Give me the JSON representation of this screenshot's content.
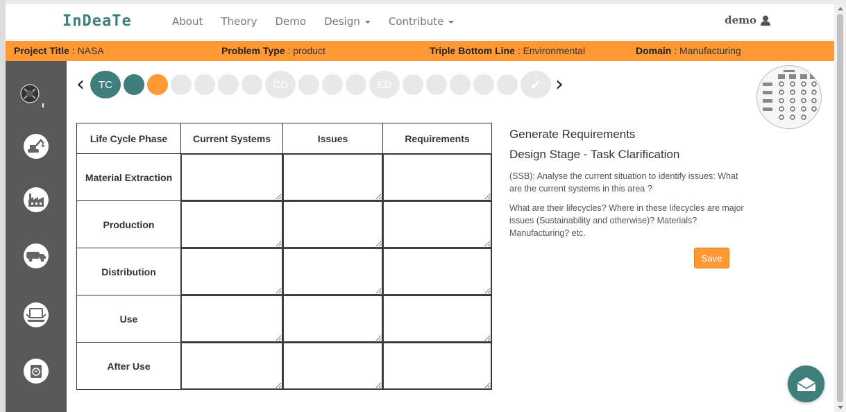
{
  "nav": {
    "brand": "InDeaTe",
    "links": [
      "About",
      "Theory",
      "Demo",
      "Design",
      "Contribute"
    ],
    "user": "demo"
  },
  "infobar": [
    {
      "label": "Project Title",
      "value": "NASA"
    },
    {
      "label": "Problem Type",
      "value": "product"
    },
    {
      "label": "Triple Bottom Line",
      "value": "Environmental"
    },
    {
      "label": "Domain",
      "value": "Manufacturing"
    }
  ],
  "sidebar": {
    "icons": [
      "gear-cycle-icon",
      "excavator-icon",
      "factory-icon",
      "truck-icon",
      "laptop-icon",
      "recycle-bin-icon"
    ]
  },
  "stepper": {
    "steps": [
      "TC",
      "",
      "",
      "",
      "",
      "",
      "",
      "CD",
      "",
      "",
      "",
      "ED",
      "",
      "",
      "",
      "",
      ""
    ],
    "done_step": "✔",
    "colors": {
      "teal": "#3e7f7c",
      "orange": "#ff9933",
      "gray": "#e8e8e8"
    }
  },
  "table": {
    "headers": [
      "Life Cycle Phase",
      "Current Systems",
      "Issues",
      "Requirements"
    ],
    "phases": [
      "Material Extraction",
      "Production",
      "Distribution",
      "Use",
      "After Use"
    ]
  },
  "panel": {
    "title": "Generate Requirements",
    "stage": "Design Stage - Task Clarification",
    "para1": "(SSB): Analyse the current situation to identify issues: What are the current systems in this area ?",
    "para2": "What are their lifecycles? Where in these lifecycles are major issues (Sustainability and otherwise)? Materials? Manufacturing? etc.",
    "save_label": "Save"
  },
  "fab": {
    "icon": "envelope-icon"
  }
}
